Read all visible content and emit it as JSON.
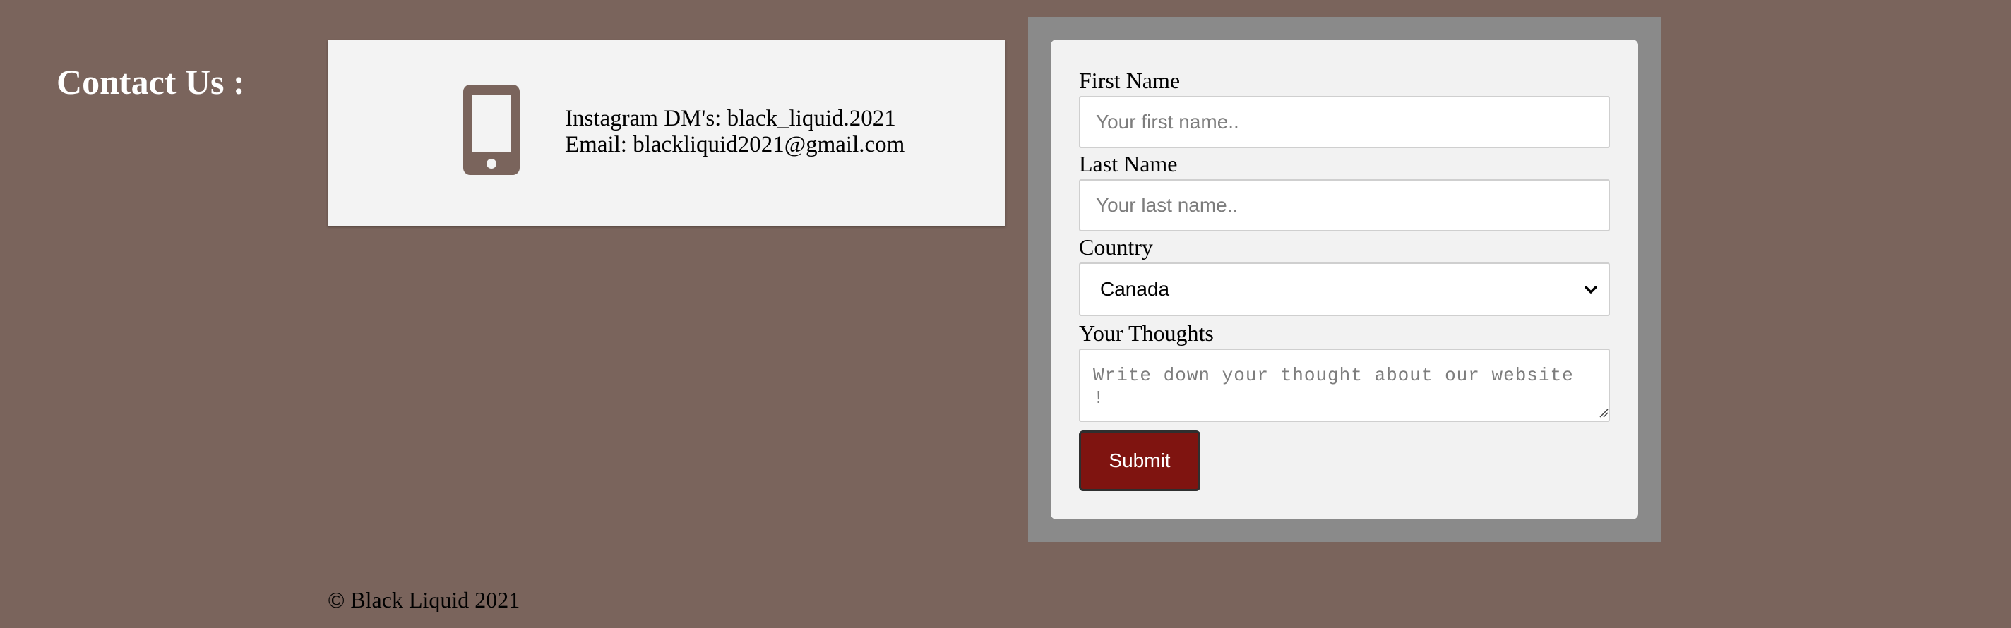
{
  "page": {
    "heading": "Contact Us :"
  },
  "contact_info": {
    "icon": "mobile-phone-icon",
    "instagram_line": "Instagram DM's: black_liquid.2021",
    "email_line": "Email: blackliquid2021@gmail.com"
  },
  "form": {
    "first_name": {
      "label": "First Name",
      "placeholder": "Your first name..",
      "value": ""
    },
    "last_name": {
      "label": "Last Name",
      "placeholder": "Your last name..",
      "value": ""
    },
    "country": {
      "label": "Country",
      "selected": "Canada"
    },
    "thoughts": {
      "label": "Your Thoughts",
      "placeholder": "Write down your thought about our website !",
      "value": ""
    },
    "submit_label": "Submit"
  },
  "footer": {
    "copyright": "© Black Liquid 2021"
  },
  "colors": {
    "page_background": "#7a645c",
    "form_frame": "#8a8a8a",
    "card_background": "#f3f3f3",
    "submit_button": "#7f1410",
    "icon_color": "#7a645c"
  }
}
